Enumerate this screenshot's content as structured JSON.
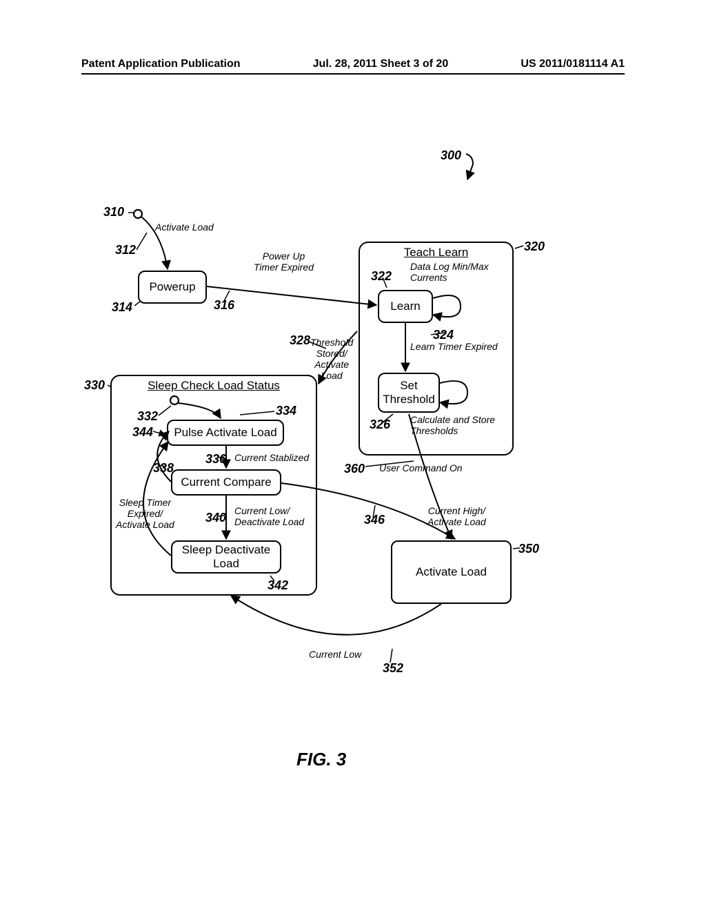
{
  "header": {
    "left": "Patent Application Publication",
    "center": "Jul. 28, 2011  Sheet 3 of 20",
    "right": "US 2011/0181114 A1"
  },
  "refs": {
    "r300": "300",
    "r310": "310",
    "r312": "312",
    "r314": "314",
    "r316": "316",
    "r320": "320",
    "r322": "322",
    "r324": "324",
    "r326": "326",
    "r328": "328",
    "r330": "330",
    "r332": "332",
    "r334": "334",
    "r336": "336",
    "r338": "338",
    "r340": "340",
    "r342": "342",
    "r344": "344",
    "r346": "346",
    "r350": "350",
    "r352": "352",
    "r360": "360"
  },
  "states": {
    "powerup": "Powerup",
    "teach_learn": "Teach Learn",
    "learn": "Learn",
    "set_threshold": "Set\nThreshold",
    "sleep_check": "Sleep Check Load Status",
    "pulse_activate": "Pulse Activate Load",
    "current_compare": "Current Compare",
    "sleep_deactivate": "Sleep Deactivate\nLoad",
    "activate_load": "Activate Load"
  },
  "edges": {
    "activate_load": "Activate Load",
    "power_up_timer": "Power Up\nTimer Expired",
    "data_log": "Data Log Min/Max\nCurrents",
    "learn_timer": "Learn Timer Expired",
    "calc_store": "Calculate and Store\nThresholds",
    "threshold_stored": "Threshold\nStored/\nActivate\nLoad",
    "current_stablized": "Current Stablized",
    "current_low_deactivate": "Current Low/\nDeactivate Load",
    "sleep_timer": "Sleep Timer\nExpired/\nActivate Load",
    "current_high": "Current High/\nActivate Load",
    "user_command": "User Command On",
    "current_low": "Current Low"
  },
  "figure_caption": "FIG. 3"
}
